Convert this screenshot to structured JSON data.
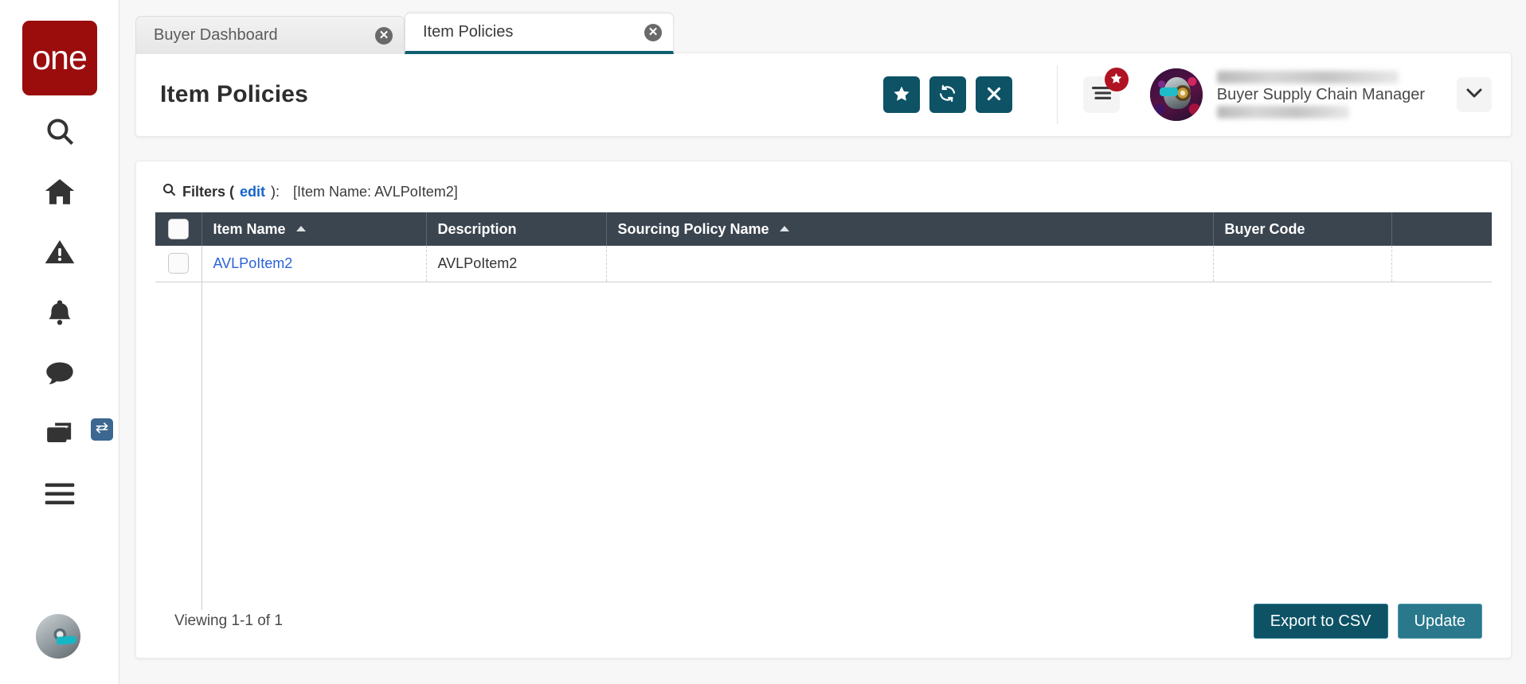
{
  "brand": {
    "logo_text": "one",
    "logo_color": "#9b0d0d"
  },
  "theme": {
    "teal_dark": "#0d5265",
    "teal_light": "#29788c",
    "table_header": "#3b4550",
    "link_blue": "#2b62d9",
    "edit_link_blue": "#1763c8",
    "badge_red": "#b01322",
    "toggle_blue": "#3b6791",
    "active_tab_underline": "#10606f"
  },
  "rail": {
    "items": [
      {
        "name": "search-icon",
        "label": "Search"
      },
      {
        "name": "home-icon",
        "label": "Home"
      },
      {
        "name": "alert-icon",
        "label": "Alerts"
      },
      {
        "name": "bell-icon",
        "label": "Notifications"
      },
      {
        "name": "chat-icon",
        "label": "Messages"
      },
      {
        "name": "windows-icon",
        "label": "Workspaces"
      },
      {
        "name": "hamburger-icon",
        "label": "Menu"
      }
    ],
    "toggle_icon": "swap-arrows-icon",
    "avatar_icon": "user-avatar"
  },
  "tabs": [
    {
      "label": "Buyer Dashboard",
      "active": false,
      "close": "✕"
    },
    {
      "label": "Item Policies",
      "active": true,
      "close": "✕"
    }
  ],
  "header": {
    "title": "Item Policies",
    "actions": [
      {
        "name": "favorite-button",
        "icon": "star-icon",
        "title": "Favorite"
      },
      {
        "name": "refresh-button",
        "icon": "refresh-icon",
        "title": "Refresh"
      },
      {
        "name": "close-button",
        "icon": "close-icon",
        "title": "Close"
      }
    ],
    "menu_button": {
      "name": "notifications-menu-button",
      "icon": "hamburger-icon",
      "badge_icon": "star-icon"
    },
    "user": {
      "name_redacted": true,
      "role": "Buyer Supply Chain Manager",
      "caret_icon": "chevron-down-icon"
    }
  },
  "filters": {
    "icon": "search-icon",
    "label": "Filters (",
    "edit_label": "edit",
    "label_tail": "):",
    "value": "[Item Name: AVLPoItem2]"
  },
  "grid": {
    "columns": [
      {
        "key": "check",
        "label": "",
        "sortable": false,
        "sort": ""
      },
      {
        "key": "name",
        "label": "Item Name",
        "sortable": true,
        "sort": "asc"
      },
      {
        "key": "desc",
        "label": "Description",
        "sortable": true,
        "sort": ""
      },
      {
        "key": "policy",
        "label": "Sourcing Policy Name",
        "sortable": true,
        "sort": "asc"
      },
      {
        "key": "buyer",
        "label": "Buyer Code",
        "sortable": true,
        "sort": ""
      },
      {
        "key": "end",
        "label": "",
        "sortable": false,
        "sort": ""
      }
    ],
    "rows": [
      {
        "selected": false,
        "name": "AVLPoItem2",
        "name_is_link": true,
        "desc": "AVLPoItem2",
        "policy": "",
        "buyer": "",
        "end": ""
      }
    ]
  },
  "footer": {
    "viewing": "Viewing 1-1 of 1",
    "export_label": "Export to CSV",
    "update_label": "Update"
  }
}
